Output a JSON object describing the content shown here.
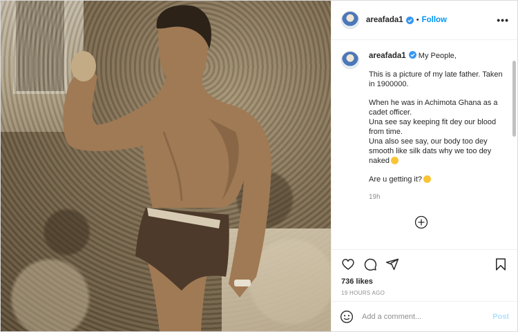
{
  "colors": {
    "accent": "#0095f6",
    "muted": "#8e8e8e",
    "post_disabled": "#b2dffc"
  },
  "header": {
    "username": "areafada1",
    "separator": "•",
    "follow_label": "Follow",
    "more_label": "•••"
  },
  "caption": {
    "username": "areafada1",
    "lines": [
      "My People,",
      "This is a picture of my late father. Taken in 1900000.",
      "When he was in Achimota Ghana as a cadet officer.",
      "Una see say keeping fit dey our blood from time.",
      "Una also see say, our body too dey smooth like silk dats why we too dey naked",
      "Are u getting it?"
    ],
    "time_ago": "19h"
  },
  "actions": {
    "icons": [
      "heart-icon",
      "comment-icon",
      "share-icon",
      "bookmark-icon"
    ],
    "likes": "736 likes",
    "posted": "19 HOURS AGO"
  },
  "composer": {
    "placeholder": "Add a comment...",
    "post_label": "Post"
  }
}
